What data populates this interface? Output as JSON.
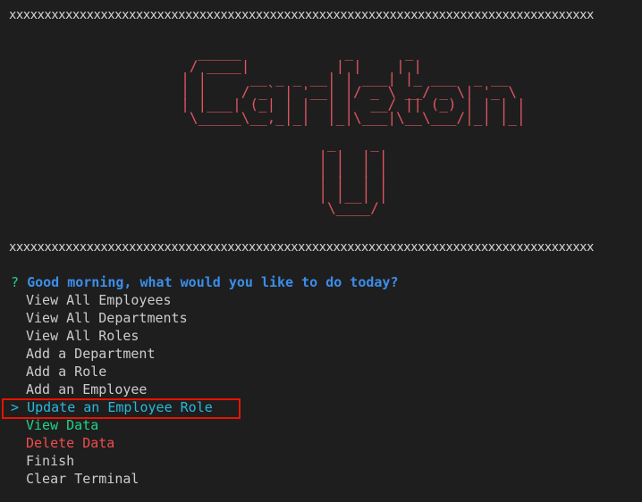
{
  "separator_top": "xxxxxxxxxxxxxxxxxxxxxxxxxxxxxxxxxxxxxxxxxxxxxxxxxxxxxxxxxxxxxxxxxxxxxxxxxxxxxxxxxxx",
  "separator_bottom": "xxxxxxxxxxxxxxxxxxxxxxxxxxxxxxxxxxxxxxxxxxxxxxxxxxxxxxxxxxxxxxxxxxxxxxxxxxxxxxxxxxx",
  "banner": "                       _____            _      _                    \n                      / ____|          | |    | |                   \n                     | |     __ _ _ __| | ___| |_ ___  _ __       \n                     | |    / _` | '__| |/ _ \\ __/ _ \\| '_ \\      \n                     | |___| (_| | |  | |  __/ || (_) | | | |     \n                      \\_____\\__,_|_|  |_|\\___|\\__\\___/|_| |_|     \n                                                                    \n                                      _    _                        \n                                     | |  | |                       \n                                     | |  | |                       \n                                     | |  | |                       \n                                     | |__| |                       \n                                      \\____/                        ",
  "prompt": {
    "question_mark": "?",
    "question": "Good morning, what would you like to do today?"
  },
  "choices": [
    {
      "label": "View All Employees",
      "selected": false
    },
    {
      "label": "View All Departments",
      "selected": false
    },
    {
      "label": "View All Roles",
      "selected": false
    },
    {
      "label": "Add a Department",
      "selected": false
    },
    {
      "label": "Add a Role",
      "selected": false
    },
    {
      "label": "Add an Employee",
      "selected": false
    },
    {
      "label": "Update an Employee Role",
      "selected": true,
      "pointer": ">"
    },
    {
      "label": "View Data",
      "selected": false
    },
    {
      "label": "Delete Data",
      "selected": false
    },
    {
      "label": "Finish",
      "selected": false
    },
    {
      "label": "Clear Terminal",
      "selected": false
    }
  ],
  "colors": {
    "background": "#1e1e1e",
    "banner": "#e05561",
    "question": "#3b8eea",
    "question_mark": "#23d18b",
    "selected": "#29b8db",
    "view_data": "#23d18b",
    "delete_data": "#f14c4c",
    "highlight_border": "#e51400"
  }
}
